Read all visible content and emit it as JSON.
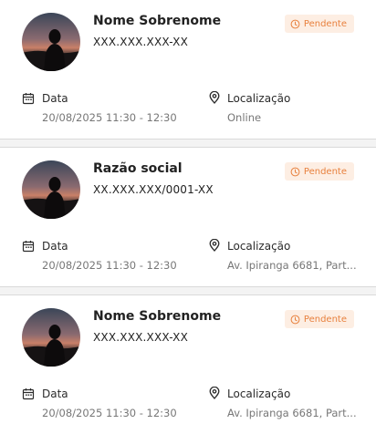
{
  "theme": {
    "badge_text_color": "#e8813e",
    "badge_bg_color": "#fdeee3"
  },
  "appointments": [
    {
      "name": "Nome Sobrenome",
      "document": "XXX.XXX.XXX-XX",
      "status": "Pendente",
      "date_label": "Data",
      "date_value": "20/08/2025 11:30 - 12:30",
      "location_label": "Localização",
      "location_value": "Online"
    },
    {
      "name": "Razão social",
      "document": "XX.XXX.XXX/0001-XX",
      "status": "Pendente",
      "date_label": "Data",
      "date_value": "20/08/2025 11:30 - 12:30",
      "location_label": "Localização",
      "location_value": "Av. Ipiranga 6681, Part..."
    },
    {
      "name": "Nome Sobrenome",
      "document": "XXX.XXX.XXX-XX",
      "status": "Pendente",
      "date_label": "Data",
      "date_value": "20/08/2025 11:30 - 12:30",
      "location_label": "Localização",
      "location_value": "Av. Ipiranga 6681, Part..."
    }
  ],
  "icons": {
    "avatar": "person-silhouette-avatar",
    "status": "clock-icon",
    "date": "calendar-icon",
    "location": "map-pin-icon"
  }
}
